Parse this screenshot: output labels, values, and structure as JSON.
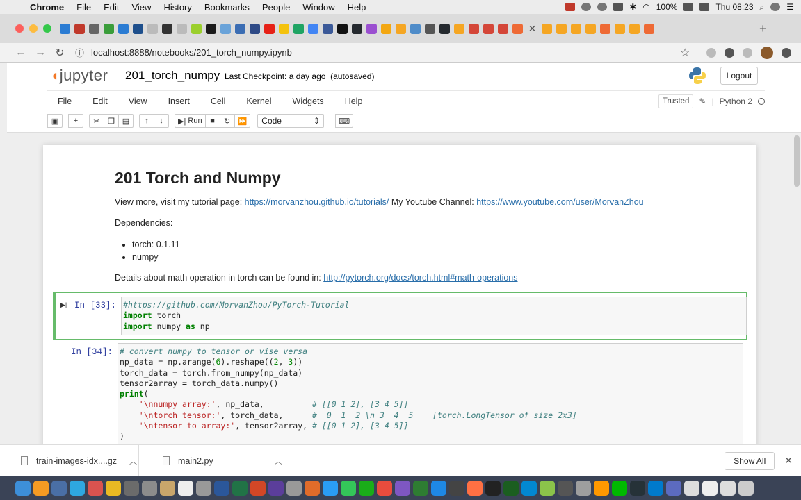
{
  "menubar": {
    "app": "Chrome",
    "items": [
      "File",
      "Edit",
      "View",
      "History",
      "Bookmarks",
      "People",
      "Window",
      "Help"
    ],
    "battery": "100%",
    "clock": "Thu 08:23"
  },
  "addressbar": {
    "url": "localhost:8888/notebooks/201_torch_numpy.ipynb"
  },
  "jupyter": {
    "logo_text": "jupyter",
    "notebook_name": "201_torch_numpy",
    "checkpoint": "Last Checkpoint: a day ago",
    "autosave": "(autosaved)",
    "logout_label": "Logout",
    "menu": [
      "File",
      "Edit",
      "View",
      "Insert",
      "Cell",
      "Kernel",
      "Widgets",
      "Help"
    ],
    "trusted_label": "Trusted",
    "kernel_name": "Python 2",
    "run_label": "Run",
    "cell_type": "Code"
  },
  "markdown": {
    "title": "201 Torch and Numpy",
    "visit_text": "View more, visit my tutorial page: ",
    "tutorial_link": "https://morvanzhou.github.io/tutorials/",
    "channel_text": " My Youtube Channel: ",
    "youtube_link": "https://www.youtube.com/user/MorvanZhou",
    "deps_label": "Dependencies:",
    "deps": [
      "torch: 0.1.11",
      "numpy"
    ],
    "details_text": "Details about math operation in torch can be found in: ",
    "details_link": "http://pytorch.org/docs/torch.html#math-operations"
  },
  "cells": [
    {
      "prompt": "In [33]:",
      "lines": [
        {
          "parts": [
            {
              "t": "#https://github.com/MorvanZhou/PyTorch-Tutorial",
              "c": "cm-comment"
            }
          ]
        },
        {
          "parts": [
            {
              "t": "import",
              "c": "cm-keyword"
            },
            {
              "t": " torch",
              "c": ""
            }
          ]
        },
        {
          "parts": [
            {
              "t": "import",
              "c": "cm-keyword"
            },
            {
              "t": " numpy ",
              "c": ""
            },
            {
              "t": "as",
              "c": "cm-keyword"
            },
            {
              "t": " np",
              "c": ""
            }
          ]
        }
      ]
    },
    {
      "prompt": "In [34]:",
      "lines": [
        {
          "parts": [
            {
              "t": "# convert numpy to tensor or vise versa",
              "c": "cm-comment"
            }
          ]
        },
        {
          "parts": [
            {
              "t": "np_data = np.arange(",
              "c": ""
            },
            {
              "t": "6",
              "c": "cm-number"
            },
            {
              "t": ").reshape((",
              "c": ""
            },
            {
              "t": "2",
              "c": "cm-number"
            },
            {
              "t": ", ",
              "c": ""
            },
            {
              "t": "3",
              "c": "cm-number"
            },
            {
              "t": "))",
              "c": ""
            }
          ]
        },
        {
          "parts": [
            {
              "t": "torch_data = torch.from_numpy(np_data)",
              "c": ""
            }
          ]
        },
        {
          "parts": [
            {
              "t": "tensor2array = torch_data.numpy()",
              "c": ""
            }
          ]
        },
        {
          "parts": [
            {
              "t": "print",
              "c": "cm-keyword"
            },
            {
              "t": "(",
              "c": ""
            }
          ]
        },
        {
          "parts": [
            {
              "t": "    ",
              "c": ""
            },
            {
              "t": "'\\nnumpy array:'",
              "c": "cm-string"
            },
            {
              "t": ", np_data,          ",
              "c": ""
            },
            {
              "t": "# [[0 1 2], [3 4 5]]",
              "c": "cm-comment"
            }
          ]
        },
        {
          "parts": [
            {
              "t": "    ",
              "c": ""
            },
            {
              "t": "'\\ntorch tensor:'",
              "c": "cm-string"
            },
            {
              "t": ", torch_data,      ",
              "c": ""
            },
            {
              "t": "#  0  1  2 \\n 3  4  5    [torch.LongTensor of size 2x3]",
              "c": "cm-comment"
            }
          ]
        },
        {
          "parts": [
            {
              "t": "    ",
              "c": ""
            },
            {
              "t": "'\\ntensor to array:'",
              "c": "cm-string"
            },
            {
              "t": ", tensor2array, ",
              "c": ""
            },
            {
              "t": "# [[0 1 2], [3 4 5]]",
              "c": "cm-comment"
            }
          ]
        },
        {
          "parts": [
            {
              "t": ")",
              "c": ""
            }
          ]
        }
      ]
    }
  ],
  "downloads": {
    "items": [
      "train-images-idx....gz",
      "main2.py"
    ],
    "show_all_label": "Show All"
  }
}
